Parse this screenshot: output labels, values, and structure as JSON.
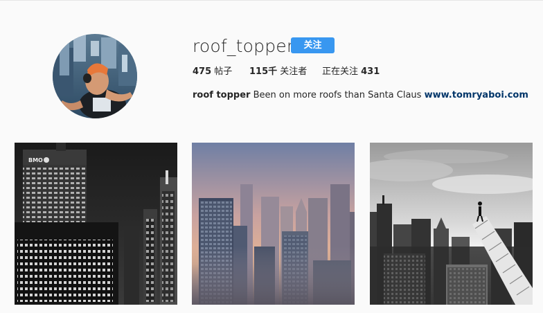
{
  "profile": {
    "username": "roof_topper",
    "follow_label": "关注",
    "stats": {
      "posts_count": "475",
      "posts_label": " 帖子",
      "followers_count": "115千",
      "followers_label": " 关注者",
      "following_label": "正在关注 ",
      "following_count": "431"
    },
    "bio": {
      "full_name": "roof topper",
      "text": " Been on more roofs than Santa Claus ",
      "link": "www.tomryaboi.com"
    }
  },
  "posts": [
    {
      "subject": "bmo-tower-night-grayscale"
    },
    {
      "subject": "city-skyline-sunrise-color"
    },
    {
      "subject": "crane-climber-grayscale"
    }
  ],
  "colors": {
    "follow_button": "#3897f0",
    "background": "#fafafa",
    "text": "#262626",
    "link": "#003569"
  }
}
